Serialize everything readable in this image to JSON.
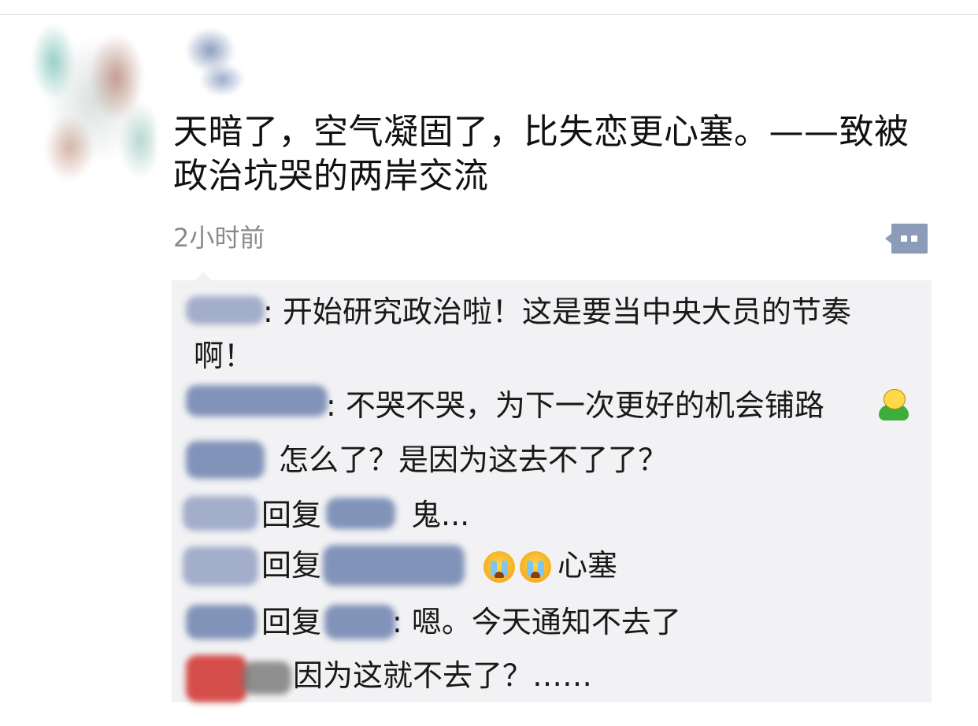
{
  "post": {
    "text": "天暗了，空气凝固了，比失恋更心塞。——致被政治坑哭的两岸交流",
    "timestamp": "2小时前"
  },
  "icons": {
    "comment_action": "comment-bubble-icon",
    "emoji_smile": "smiley-emoji-icon",
    "emoji_cry": "crying-emoji-icon"
  },
  "comments": [
    {
      "text_line1": ": 开始研究政治啦！这是要当中央大员的节奏",
      "text_line2": "啊！"
    },
    {
      "text": ": 不哭不哭，为下一次更好的机会铺路"
    },
    {
      "text": "怎么了？是因为这去不了了？"
    },
    {
      "reply_label": "回复",
      "text": "鬼..."
    },
    {
      "reply_label": "回复",
      "text_after_emoji": "心塞"
    },
    {
      "reply_label": "回复",
      "text": ": 嗯。今天通知不去了"
    },
    {
      "text": "因为这就不去了？……"
    }
  ],
  "colors": {
    "panel_bg": "#f2f2f4",
    "timestamp": "#8a8a8a",
    "action_icon": "#8b9bb8"
  }
}
